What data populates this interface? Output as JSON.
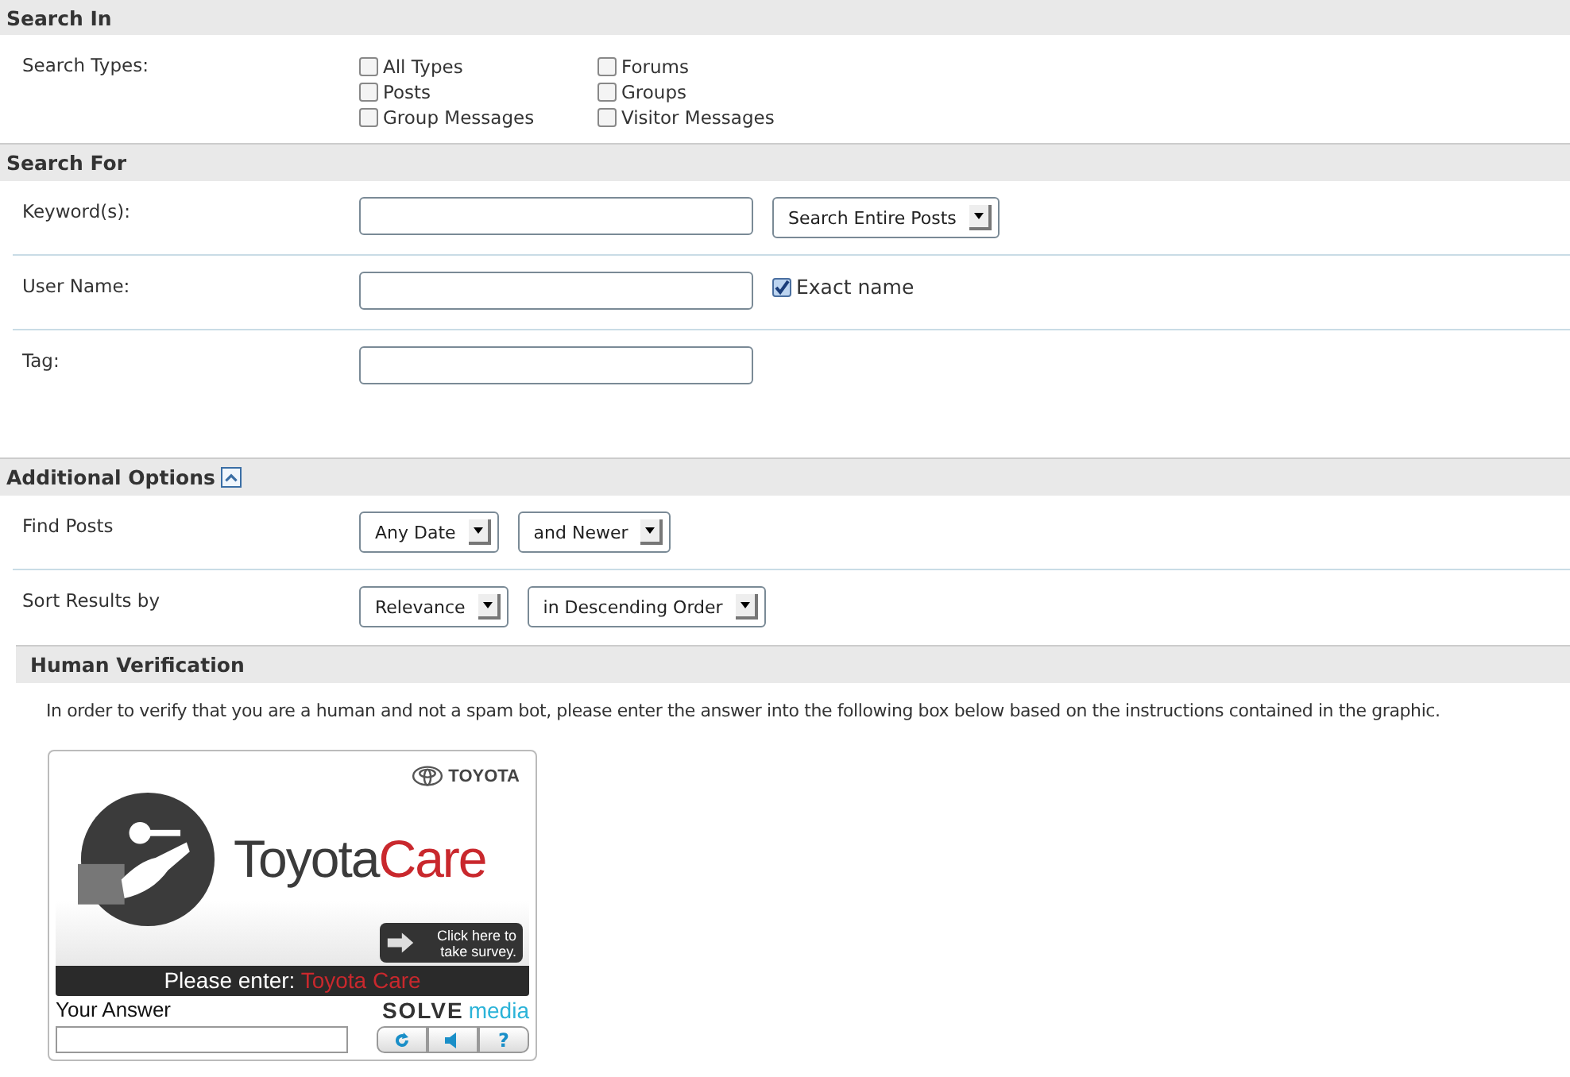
{
  "search_in": {
    "title": "Search In",
    "label": "Search Types:",
    "types": [
      {
        "label": "All Types",
        "checked": false
      },
      {
        "label": "Posts",
        "checked": false
      },
      {
        "label": "Group Messages",
        "checked": false
      },
      {
        "label": "Forums",
        "checked": false
      },
      {
        "label": "Groups",
        "checked": false
      },
      {
        "label": "Visitor Messages",
        "checked": false
      }
    ]
  },
  "search_for": {
    "title": "Search For",
    "rows": [
      {
        "kind": "select",
        "label": "Keyword(s):",
        "select": "Search Entire Posts"
      },
      {
        "kind": "check",
        "label": "User Name:",
        "check": {
          "label": "Exact name",
          "checked": true
        }
      },
      {
        "kind": "plain",
        "label": "Tag:"
      }
    ]
  },
  "additional_options": {
    "title": "Additional Options",
    "expanded": true,
    "rows": [
      {
        "label": "Find Posts",
        "selects": [
          "Any Date",
          "and Newer"
        ]
      },
      {
        "label": "Sort Results by",
        "selects": [
          "Relevance",
          "in Descending Order"
        ]
      }
    ]
  },
  "human_verification": {
    "title": "Human Verification",
    "instructions": "In order to verify that you are a human and not a spam bot, please enter the answer into the following box below based on the instructions contained in the graphic.",
    "captcha": {
      "brand": "TOYOTA",
      "headline_dark": "Toyota",
      "headline_red": "Care",
      "survey": "Click here to take survey.",
      "prompt": "Please enter: ",
      "prompt_answer": "Toyota Care",
      "answer_label": "Your Answer",
      "provider_a": "SOLVE",
      "provider_b": "media",
      "buttons": [
        "?"
      ]
    }
  }
}
